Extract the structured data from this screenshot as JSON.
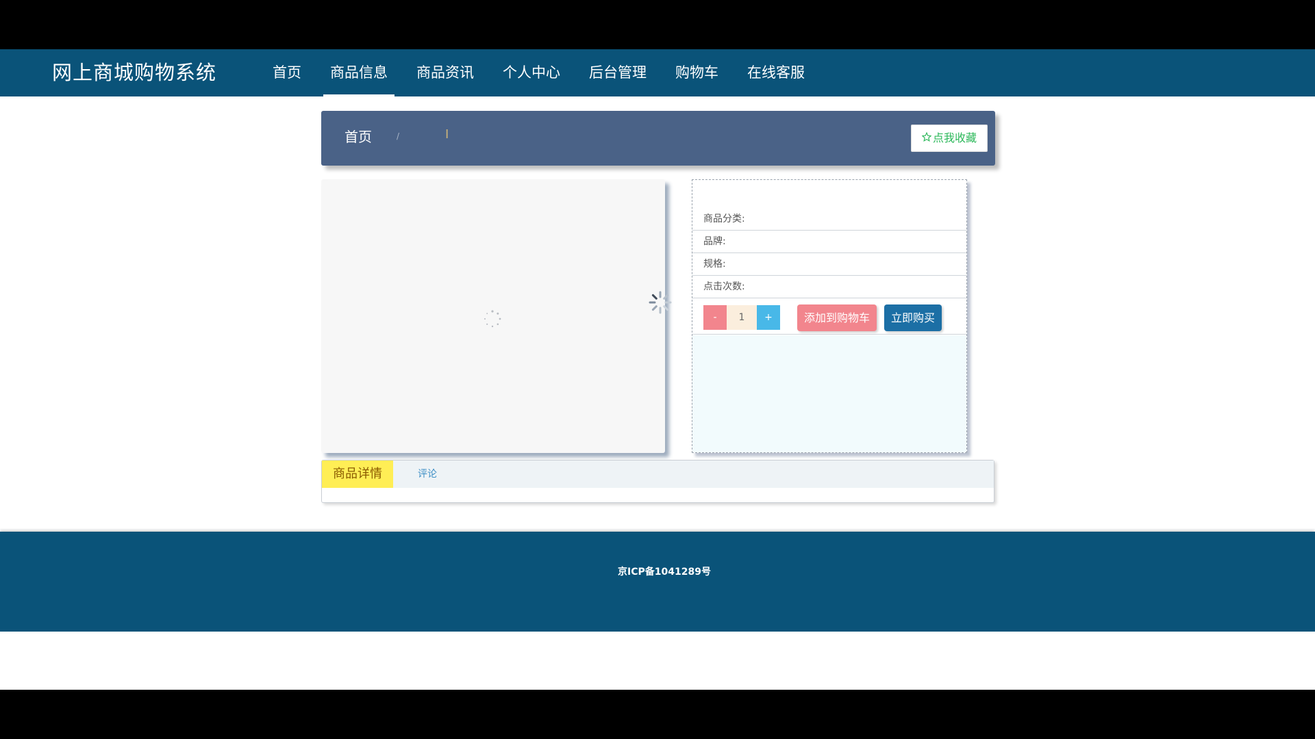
{
  "app": {
    "brand": "网上商城购物系统"
  },
  "nav": {
    "items": [
      {
        "label": "首页"
      },
      {
        "label": "商品信息",
        "active": true
      },
      {
        "label": "商品资讯"
      },
      {
        "label": "个人中心"
      },
      {
        "label": "后台管理"
      },
      {
        "label": "购物车"
      },
      {
        "label": "在线客服"
      }
    ]
  },
  "breadcrumb": {
    "home": "首页",
    "separator": "/",
    "cursor": "I"
  },
  "favorite": {
    "icon": "star-outline-icon",
    "label": "点我收藏"
  },
  "product": {
    "fields": [
      {
        "label": "商品分类:"
      },
      {
        "label": "品牌:"
      },
      {
        "label": "规格:"
      },
      {
        "label": "点击次数:"
      }
    ],
    "quantity": {
      "minus": "-",
      "value": "1",
      "plus": "+"
    },
    "add_to_cart": "添加到购物车",
    "buy_now": "立即购买"
  },
  "tabs": {
    "detail": "商品详情",
    "review": "评论"
  },
  "footer": {
    "icp": "京ICP备1041289号"
  },
  "colors": {
    "nav": "#0a5379",
    "crumb_bar": "#4a6287",
    "minus": "#f2858d",
    "plus": "#48b8e8",
    "buy_now": "#1c6fa5",
    "tab_active": "#ffee55",
    "favorite_text": "#2cb85a"
  }
}
